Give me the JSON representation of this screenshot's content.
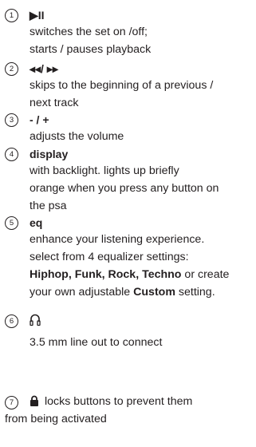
{
  "items": [
    {
      "number": "1",
      "heading": "▶II",
      "lines": [
        "switches the set on  /off;",
        "starts / pauses playback"
      ]
    },
    {
      "number": "2",
      "heading": "◂◂/ ▸▸",
      "lines": [
        "skips to the beginning of a previous /",
        "next track"
      ]
    },
    {
      "number": "3",
      "heading": "- / +",
      "lines": [
        "adjusts the volume"
      ]
    },
    {
      "number": "4",
      "heading": "display",
      "lines": [
        "with backlight. lights up briefly",
        "orange when you press any button on",
        "the psa"
      ]
    },
    {
      "number": "5",
      "heading": "eq",
      "lines": [
        "enhance your listening experience.",
        "select from 4 equalizer settings:"
      ],
      "eq_line3": {
        "bold": "Hiphop, Funk, Rock, Techno",
        "rest": " or create"
      },
      "eq_line4": {
        "pre": "your own adjustable ",
        "bold": "Custom",
        "post": " setting."
      }
    },
    {
      "number": "6",
      "icon": "headphones-icon",
      "lines": [
        "3.5 mm line out to connect"
      ]
    },
    {
      "number": "7",
      "icon": "padlock-icon",
      "line1": "locks buttons to prevent them",
      "line2": "from being activated"
    }
  ]
}
